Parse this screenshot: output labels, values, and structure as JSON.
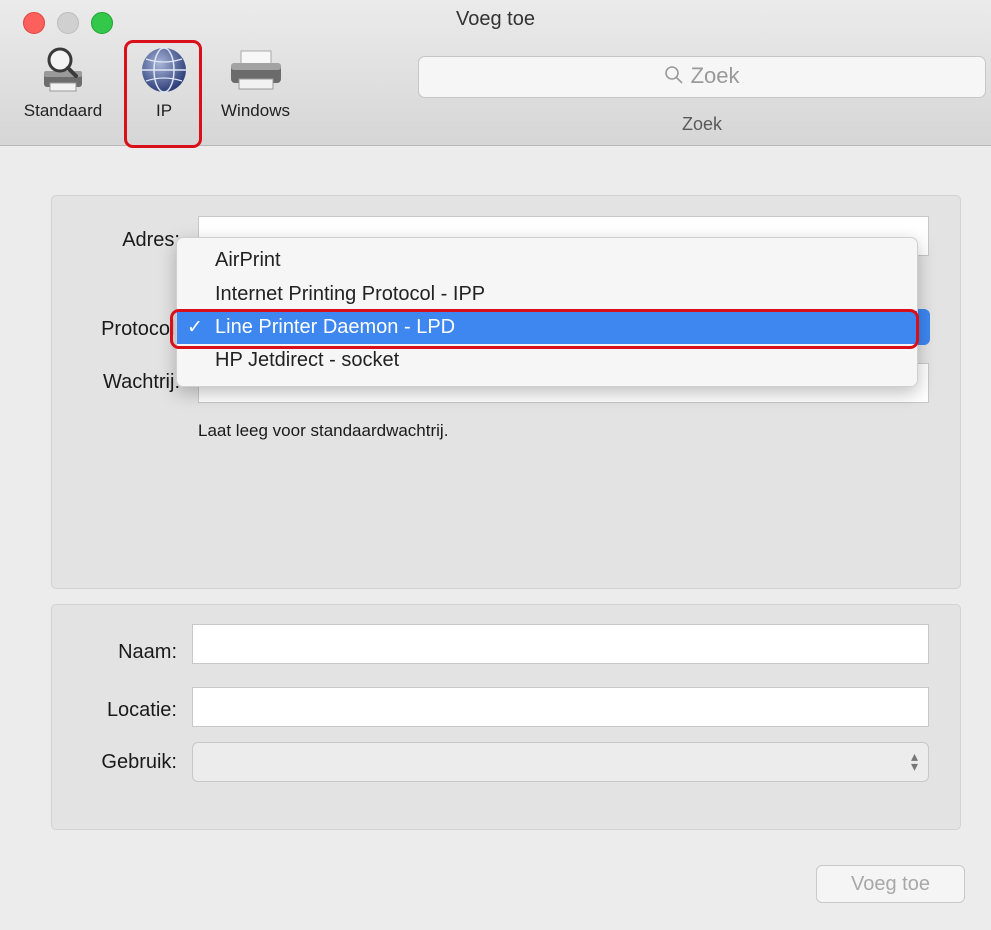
{
  "window": {
    "title": "Voeg toe"
  },
  "toolbar": {
    "items": [
      {
        "label": "Standaard",
        "icon": "magnifier-printer-icon"
      },
      {
        "label": "IP",
        "icon": "globe-icon",
        "selected": true
      },
      {
        "label": "Windows",
        "icon": "printer-icon"
      }
    ],
    "search_placeholder": "Zoek",
    "search_label": "Zoek"
  },
  "form_top": {
    "address_label": "Adres:",
    "protocol_label": "Protocol:",
    "queue_label": "Wachtrij:",
    "queue_hint": "Laat leeg voor standaardwachtrij."
  },
  "protocol_menu": {
    "items": [
      {
        "label": "AirPrint",
        "selected": false
      },
      {
        "label": "Internet Printing Protocol - IPP",
        "selected": false
      },
      {
        "label": "Line Printer Daemon - LPD",
        "selected": true
      },
      {
        "label": "HP Jetdirect - socket",
        "selected": false
      }
    ],
    "check_glyph": "✓"
  },
  "form_bottom": {
    "name_label": "Naam:",
    "location_label": "Locatie:",
    "use_label": "Gebruik:"
  },
  "footer": {
    "add_button": "Voeg toe"
  },
  "colors": {
    "accent": "#3e87f0",
    "highlight_border": "#d9101a"
  }
}
